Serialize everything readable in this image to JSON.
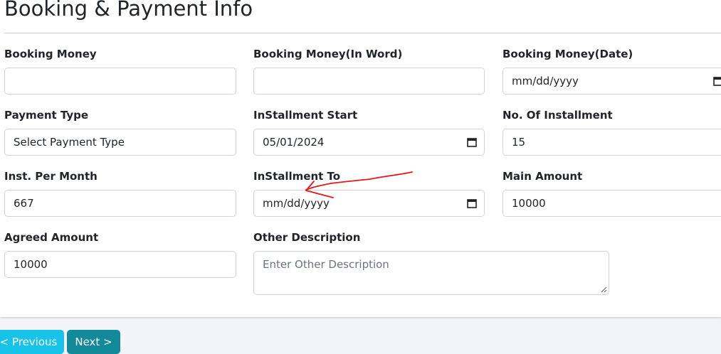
{
  "page": {
    "title": "Booking & Payment Info"
  },
  "fields": {
    "booking_money": {
      "label": "Booking Money",
      "value": ""
    },
    "booking_money_word": {
      "label": "Booking Money(In Word)",
      "value": ""
    },
    "booking_money_date": {
      "label": "Booking Money(Date)",
      "placeholder": "mm/dd/yyyy"
    },
    "payment_type": {
      "label": "Payment Type",
      "value": "Select Payment Type"
    },
    "installment_start": {
      "label": "InStallment Start",
      "value": "05/01/2024"
    },
    "no_of_installment": {
      "label": "No. Of Installment",
      "value": "15"
    },
    "inst_per_month": {
      "label": "Inst. Per Month",
      "value": "667"
    },
    "installment_to": {
      "label": "InStallment To",
      "placeholder": "mm/dd/yyyy"
    },
    "main_amount": {
      "label": "Main Amount",
      "value": "10000"
    },
    "agreed_amount": {
      "label": "Agreed Amount",
      "value": "10000"
    },
    "other_description": {
      "label": "Other Description",
      "placeholder": "Enter Other Description"
    }
  },
  "buttons": {
    "previous": "< Previous",
    "next": "Next >"
  },
  "colors": {
    "previous_bg": "#17c3e8",
    "next_bg": "#128a99",
    "annotation": "#e8141c"
  },
  "icons": {
    "calendar": "calendar-icon",
    "resize": "resize-handle-icon",
    "annotation": "red-arrow-annotation"
  }
}
